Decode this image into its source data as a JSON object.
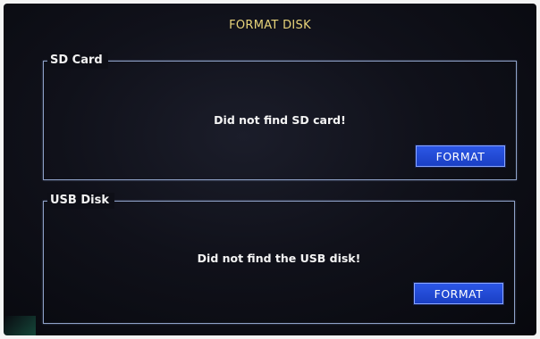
{
  "dialog": {
    "title": "FORMAT DISK"
  },
  "sd_card": {
    "label": "SD Card",
    "message": "Did not find SD card!",
    "button_label": "FORMAT"
  },
  "usb_disk": {
    "label": "USB Disk",
    "message": "Did not find the USB disk!",
    "button_label": "FORMAT"
  },
  "colors": {
    "title": "#e8d47a",
    "button": "#2c57e6",
    "frame": "#8fa2c8",
    "background": "#10111a"
  }
}
